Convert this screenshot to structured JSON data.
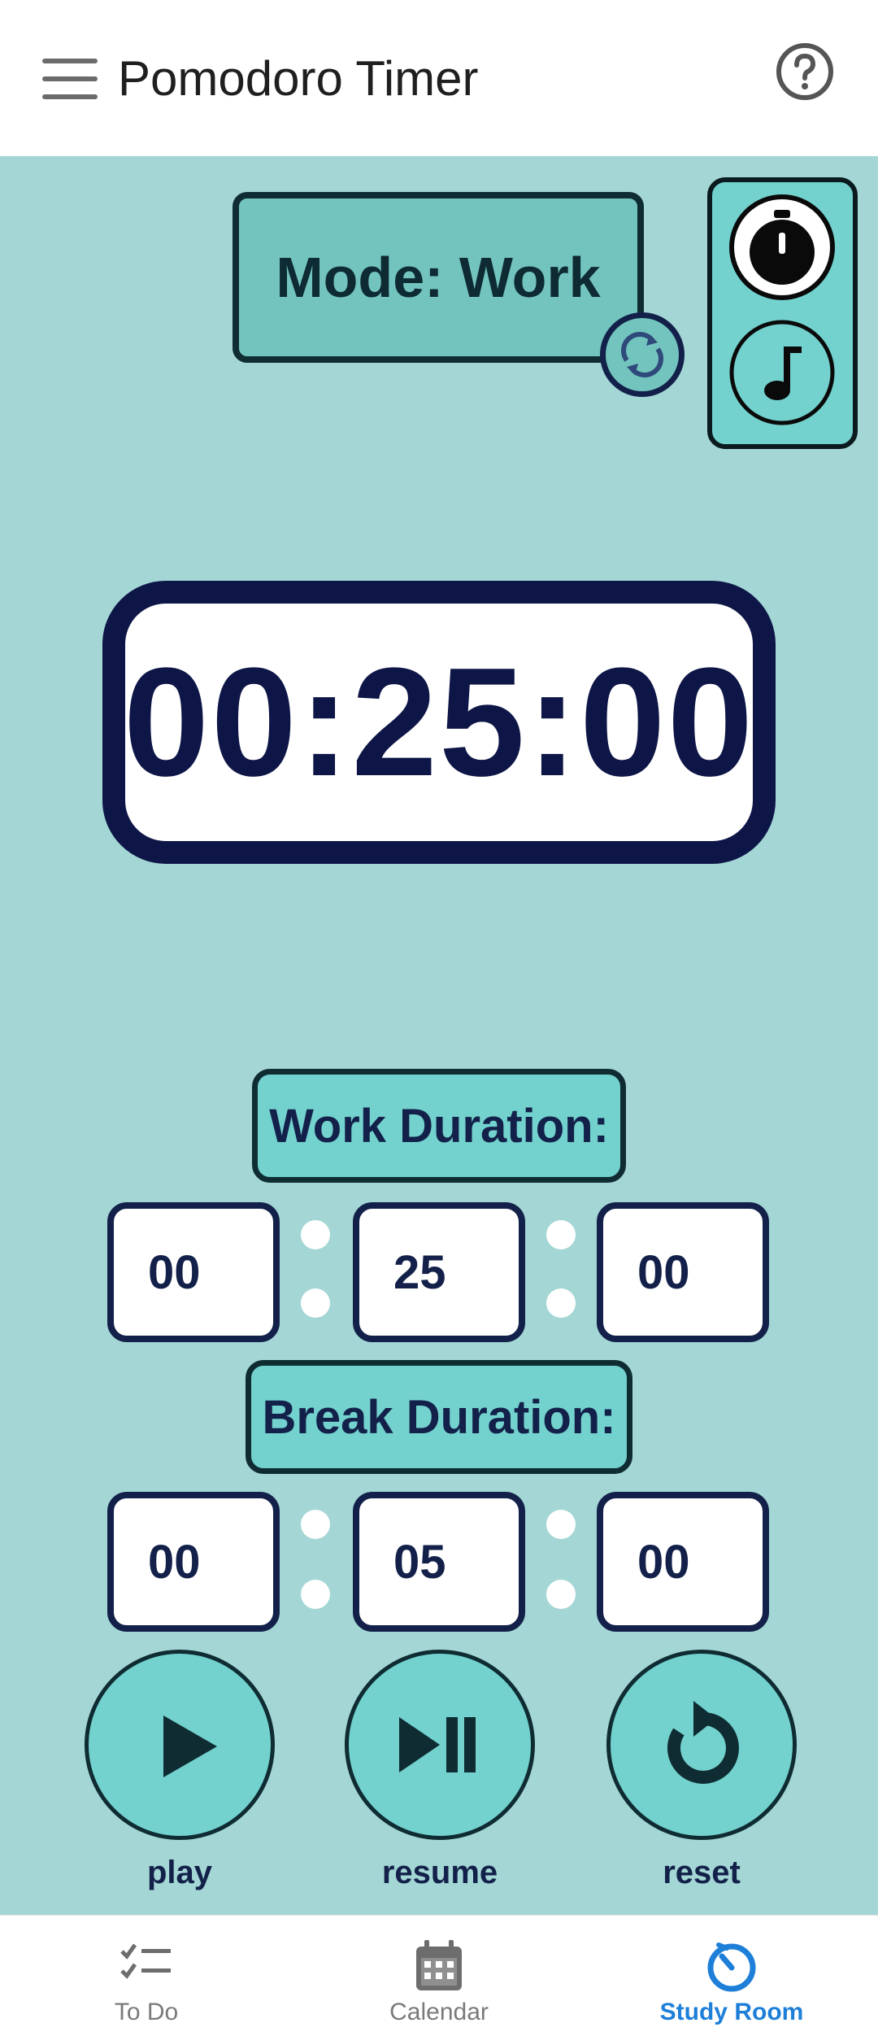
{
  "appbar": {
    "title": "Pomodoro Timer",
    "menu_icon": "hamburger-menu-icon",
    "help_icon": "help-circle-icon"
  },
  "mode": {
    "label": "Mode: Work",
    "toggle_icon": "sync-icon"
  },
  "side_panel": {
    "stopwatch_icon": "stopwatch-icon",
    "music_icon": "music-note-icon"
  },
  "timer": {
    "display": "00:25:00"
  },
  "work_duration": {
    "label": "Work Duration:",
    "hours": "00",
    "minutes": "25",
    "seconds": "00"
  },
  "break_duration": {
    "label": "Break Duration:",
    "hours": "00",
    "minutes": "05",
    "seconds": "00"
  },
  "controls": {
    "play_label": "play",
    "resume_label": "resume",
    "reset_label": "reset"
  },
  "bottom_nav": {
    "items": [
      {
        "label": "To Do",
        "icon": "checklist-icon"
      },
      {
        "label": "Calendar",
        "icon": "calendar-icon"
      },
      {
        "label": "Study Room",
        "icon": "timer-dial-icon",
        "active": true
      }
    ]
  },
  "colors": {
    "background": "#a3d6d4",
    "accent": "#73d2ce",
    "navy": "#13214a",
    "active_nav": "#1e7fd8"
  }
}
